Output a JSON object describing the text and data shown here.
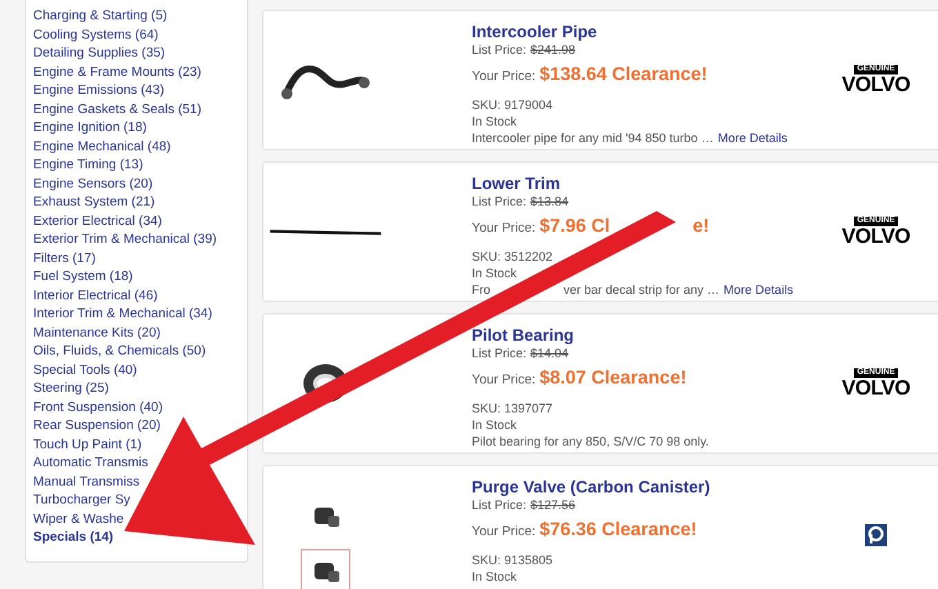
{
  "sidebar": {
    "items": [
      {
        "label": "Charging & Starting (5)",
        "selected": false
      },
      {
        "label": "Cooling Systems (64)",
        "selected": false
      },
      {
        "label": "Detailing Supplies (35)",
        "selected": false
      },
      {
        "label": "Engine & Frame Mounts (23)",
        "selected": false
      },
      {
        "label": "Engine Emissions (43)",
        "selected": false
      },
      {
        "label": "Engine Gaskets & Seals (51)",
        "selected": false
      },
      {
        "label": "Engine Ignition (18)",
        "selected": false
      },
      {
        "label": "Engine Mechanical (48)",
        "selected": false
      },
      {
        "label": "Engine Timing (13)",
        "selected": false
      },
      {
        "label": "Engine Sensors (20)",
        "selected": false
      },
      {
        "label": "Exhaust System (21)",
        "selected": false
      },
      {
        "label": "Exterior Electrical (34)",
        "selected": false
      },
      {
        "label": "Exterior Trim & Mechanical (39)",
        "selected": false
      },
      {
        "label": "Filters (17)",
        "selected": false
      },
      {
        "label": "Fuel System (18)",
        "selected": false
      },
      {
        "label": "Interior Electrical (46)",
        "selected": false
      },
      {
        "label": "Interior Trim & Mechanical (34)",
        "selected": false
      },
      {
        "label": "Maintenance Kits (20)",
        "selected": false
      },
      {
        "label": "Oils, Fluids, & Chemicals (50)",
        "selected": false
      },
      {
        "label": "Special Tools (40)",
        "selected": false
      },
      {
        "label": "Steering (25)",
        "selected": false
      },
      {
        "label": "Front Suspension (40)",
        "selected": false
      },
      {
        "label": "Rear Suspension (20)",
        "selected": false
      },
      {
        "label": "Touch Up Paint (1)",
        "selected": false
      },
      {
        "label": "Automatic Transmis",
        "selected": false
      },
      {
        "label": "Manual Transmiss",
        "selected": false
      },
      {
        "label": "Turbocharger Sy",
        "selected": false
      },
      {
        "label": "Wiper & Washe",
        "selected": false
      },
      {
        "label": "Specials (14)",
        "selected": true
      }
    ]
  },
  "products": [
    {
      "name": "Intercooler Pipe",
      "list_label": "List Price:",
      "list_price": "$241.98",
      "your_label": "Your Price:",
      "price_parts": [
        "$138.64 Clearance!"
      ],
      "sku": "SKU: 9179004",
      "stock": "In Stock",
      "description_parts": [
        "Intercooler pipe for any mid '94 850 turbo …"
      ],
      "more": "More Details",
      "brand": {
        "kind": "volvo",
        "top": "GENUINE",
        "name": "VOLVO"
      }
    },
    {
      "name": "Lower Trim",
      "list_label": "List Price:",
      "list_price": "$13.84",
      "your_label": "Your Price:",
      "price_parts": [
        "$7.96 Cl",
        "e!"
      ],
      "sku": "SKU: 3512202",
      "stock": "In Stock",
      "description_parts": [
        "Fro",
        "ver bar decal strip for any …"
      ],
      "more": "More Details",
      "brand": {
        "kind": "volvo",
        "top": "GENUINE",
        "name": "VOLVO"
      }
    },
    {
      "name": "Pilot Bearing",
      "list_label": "List Price:",
      "list_price": "$14.04",
      "your_label": "Your Price:",
      "price_parts": [
        "$8.07 Clearance!"
      ],
      "sku": "SKU: 1397077",
      "stock": "In Stock",
      "description_parts": [
        "Pilot bearing for any 850, S/V/C 70 98 only."
      ],
      "brand": {
        "kind": "volvo",
        "top": "GENUINE",
        "name": "VOLVO"
      }
    },
    {
      "name": "Purge Valve (Carbon Canister)",
      "list_label": "List Price:",
      "list_price": "$127.56",
      "your_label": "Your Price:",
      "price_parts": [
        "$76.36 Clearance!"
      ],
      "sku": "SKU: 9135805",
      "stock": "In Stock",
      "thumbnails": [
        {
          "selected": false
        },
        {
          "selected": true
        }
      ],
      "brand": {
        "kind": "p"
      }
    }
  ]
}
